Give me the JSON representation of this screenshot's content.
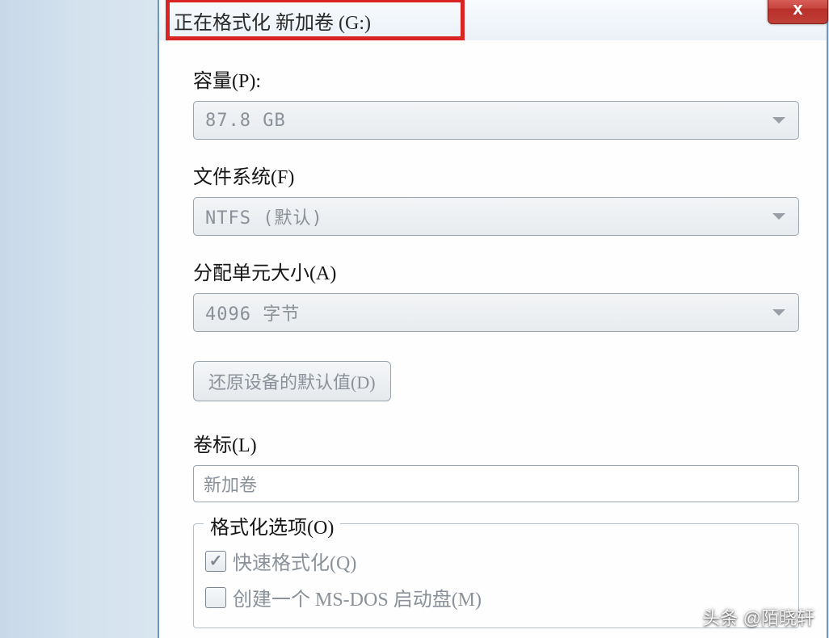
{
  "window": {
    "title": "正在格式化 新加卷 (G:)",
    "close_icon": "x"
  },
  "fields": {
    "capacity": {
      "label": "容量(P):",
      "value": "87.8 GB"
    },
    "filesystem": {
      "label": "文件系统(F)",
      "value": "NTFS (默认)"
    },
    "allocation": {
      "label": "分配单元大小(A)",
      "value": "4096 字节"
    },
    "restore_defaults": "还原设备的默认值(D)",
    "volume_label": {
      "label": "卷标(L)",
      "value": "新加卷"
    },
    "format_options": {
      "legend": "格式化选项(O)",
      "quick_format": "快速格式化(Q)",
      "create_bootdisk": "创建一个 MS-DOS 启动盘(M)"
    }
  },
  "watermark": "头条 @陌晓轩"
}
